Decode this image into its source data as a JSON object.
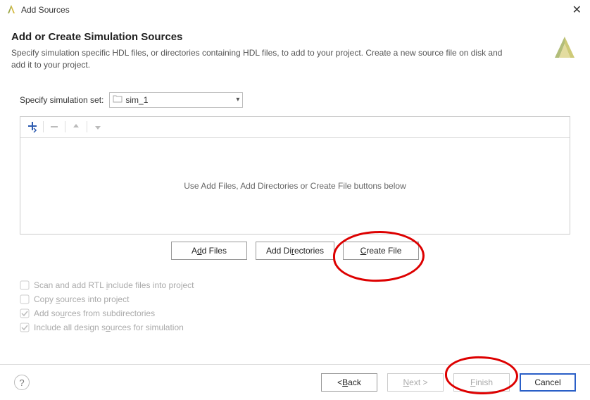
{
  "window": {
    "title": "Add Sources"
  },
  "header": {
    "title": "Add or Create Simulation Sources",
    "description": "Specify simulation specific HDL files, or directories containing HDL files, to add to your project. Create a new source file on disk and add it to your project."
  },
  "simset": {
    "label": "Specify simulation set:",
    "value": "sim_1"
  },
  "list": {
    "empty_text": "Use Add Files, Add Directories or Create File buttons below"
  },
  "file_buttons": {
    "add_files_pre": "A",
    "add_files_mn": "d",
    "add_files_post": "d Files",
    "add_dirs_pre": "Add Di",
    "add_dirs_mn": "r",
    "add_dirs_post": "ectories",
    "create_file_pre": "",
    "create_file_mn": "C",
    "create_file_post": "reate File"
  },
  "checks": {
    "scan_pre": "Scan and add RTL ",
    "scan_mn": "i",
    "scan_post": "nclude files into project",
    "copy_pre": "Copy ",
    "copy_mn": "s",
    "copy_post": "ources into project",
    "sub_pre": "Add so",
    "sub_mn": "u",
    "sub_post": "rces from subdirectories",
    "sim_pre": "Include all design s",
    "sim_mn": "o",
    "sim_post": "urces for simulation"
  },
  "footer": {
    "back_pre": "< ",
    "back_mn": "B",
    "back_post": "ack",
    "next_pre": "",
    "next_mn": "N",
    "next_post": "ext >",
    "finish_pre": "",
    "finish_mn": "F",
    "finish_post": "inish",
    "cancel": "Cancel"
  }
}
